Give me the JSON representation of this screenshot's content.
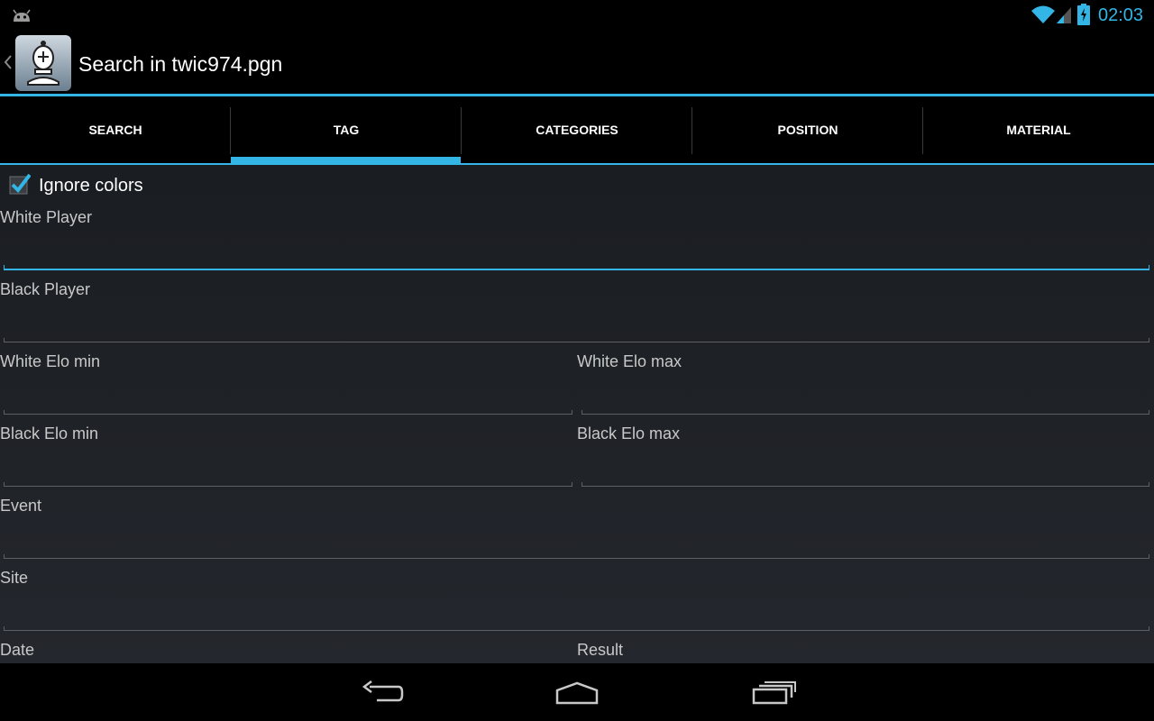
{
  "status_bar": {
    "time": "02:03",
    "icons": [
      "android-debug-icon",
      "wifi-icon",
      "signal-icon",
      "battery-charging-icon"
    ]
  },
  "action_bar": {
    "title": "Search in twic974.pgn",
    "app_icon": "chess-bishop-icon"
  },
  "tabs": [
    {
      "label": "SEARCH",
      "selected": false
    },
    {
      "label": "TAG",
      "selected": true
    },
    {
      "label": "CATEGORIES",
      "selected": false
    },
    {
      "label": "POSITION",
      "selected": false
    },
    {
      "label": "MATERIAL",
      "selected": false
    }
  ],
  "form": {
    "ignore_colors": {
      "label": "Ignore colors",
      "checked": true
    },
    "white_player": {
      "label": "White Player",
      "value": ""
    },
    "black_player": {
      "label": "Black Player",
      "value": ""
    },
    "white_elo_min": {
      "label": "White Elo min",
      "value": ""
    },
    "white_elo_max": {
      "label": "White Elo max",
      "value": ""
    },
    "black_elo_min": {
      "label": "Black Elo min",
      "value": ""
    },
    "black_elo_max": {
      "label": "Black Elo max",
      "value": ""
    },
    "event": {
      "label": "Event",
      "value": ""
    },
    "site": {
      "label": "Site",
      "value": ""
    },
    "date": {
      "label": "Date",
      "value": ""
    },
    "result": {
      "label": "Result",
      "value": ""
    }
  },
  "nav_bar": {
    "icons": [
      "back-icon",
      "home-icon",
      "recent-apps-icon"
    ]
  },
  "colors": {
    "accent": "#33b5e5",
    "background": "#1c1f24",
    "bar": "#000000"
  }
}
